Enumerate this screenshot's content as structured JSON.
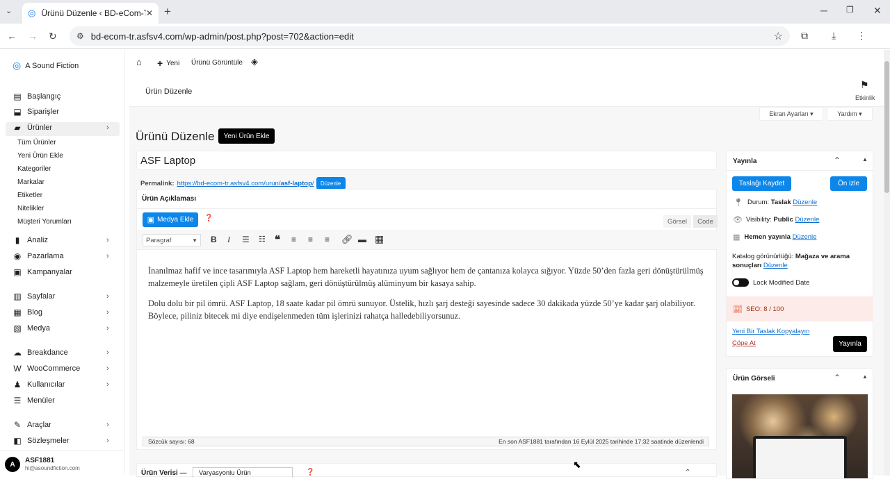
{
  "browser": {
    "tab_title": "Ürünü Düzenle ‹ BD-eCom-TR",
    "url": "bd-ecom-tr.asfsv4.com/wp-admin/post.php?post=702&action=edit"
  },
  "site": {
    "name": "A Sound Fiction"
  },
  "sidebar": {
    "items": [
      {
        "label": "Başlangıç",
        "icon": "dashboard-icon"
      },
      {
        "label": "Siparişler",
        "icon": "inbox-icon"
      },
      {
        "label": "Ürünler",
        "icon": "box-icon"
      },
      {
        "label": "Analiz",
        "icon": "bar-chart-icon"
      },
      {
        "label": "Pazarlama",
        "icon": "megaphone-icon"
      },
      {
        "label": "Kampanyalar",
        "icon": "gift-icon"
      },
      {
        "label": "Sayfalar",
        "icon": "pages-icon"
      },
      {
        "label": "Blog",
        "icon": "blog-icon"
      },
      {
        "label": "Medya",
        "icon": "media-icon"
      },
      {
        "label": "Breakdance",
        "icon": "breakdance-icon"
      },
      {
        "label": "WooCommerce",
        "icon": "woo-icon"
      },
      {
        "label": "Kullanıcılar",
        "icon": "users-icon"
      },
      {
        "label": "Menüler",
        "icon": "menu-icon"
      },
      {
        "label": "Araçlar",
        "icon": "wrench-icon"
      },
      {
        "label": "Sözleşmeler",
        "icon": "document-icon"
      }
    ],
    "submenu": [
      "Tüm Ürünler",
      "Yeni Ürün Ekle",
      "Kategoriler",
      "Markalar",
      "Etiketler",
      "Nitelikler",
      "Müşteri Yorumları"
    ],
    "user": {
      "initial": "A",
      "name": "ASF1881",
      "email": "hi@asoundfiction.com"
    }
  },
  "topbar": {
    "new_label": "Yeni",
    "view_label": "Ürünü Görüntüle"
  },
  "subheader": {
    "title": "Ürün Düzenle",
    "activity": "Etkinlik"
  },
  "screen": {
    "options": "Ekran Ayarları ▾",
    "help": "Yardım ▾"
  },
  "page": {
    "heading": "Ürünü Düzenle",
    "add_new": "Yeni Ürün Ekle"
  },
  "post": {
    "title": "ASF Laptop",
    "permalink_label": "Permalink:",
    "permalink_url_base": "https://bd-ecom-tr.asfsv4.com/urun/",
    "permalink_slug": "asf-laptop",
    "permalink_end": "/",
    "edit_button": "Düzenle",
    "desc_title": "Ürün Açıklaması",
    "add_media": "Medya Ekle",
    "tab_visual": "Görsel",
    "tab_code": "Code",
    "format": "Paragraf",
    "para1": "İnanılmaz hafif ve ince tasarımıyla ASF Laptop hem hareketli hayatınıza uyum sağlıyor hem de çantanıza kolayca sığıyor. Yüzde 50’den fazla geri dönüştürülmüş malzemeyle üretilen çipli ASF Laptop sağlam, geri dönüştürülmüş alüminyum bir kasaya sahip.",
    "para2": "Dolu dolu bir pil ömrü. ASF Laptop, 18 saate kadar pil ömrü sunuyor. Üstelik, hızlı şarj desteği sayesinde sadece 30 dakikada yüzde 50’ye kadar şarj olabiliyor. Böylece, piliniz bitecek mi diye endişelenmeden tüm işlerinizi rahatça halledebiliyorsunuz.",
    "word_count": "Sözcük sayısı: 68",
    "last_edit": "En son ASF1881 tarafından 16 Eylül 2025 tarihinde 17:32 saatinde düzenlendi"
  },
  "product_data": {
    "label": "Ürün Verisi —",
    "select": "Varyasyonlu Ürün"
  },
  "publish": {
    "title": "Yayınla",
    "save_draft": "Taslağı Kaydet",
    "preview": "Ön izle",
    "status_label": "Durum:",
    "status_value": "Taslak",
    "visibility_label": "Visibility:",
    "visibility_value": "Public",
    "publish_now": "Hemen yayınla",
    "edit_link": "Düzenle",
    "catalog_label": "Katalog görünürlüğü:",
    "catalog_value": "Mağaza ve arama sonuçları",
    "lock_label": "Lock Modified Date",
    "seo": "SEO: 8 / 100",
    "copy_draft": "Yeni Bir Taslak Kopyalayın",
    "trash": "Çöpe At",
    "publish_btn": "Yayınla"
  },
  "image_box": {
    "title": "Ürün Görseli"
  }
}
